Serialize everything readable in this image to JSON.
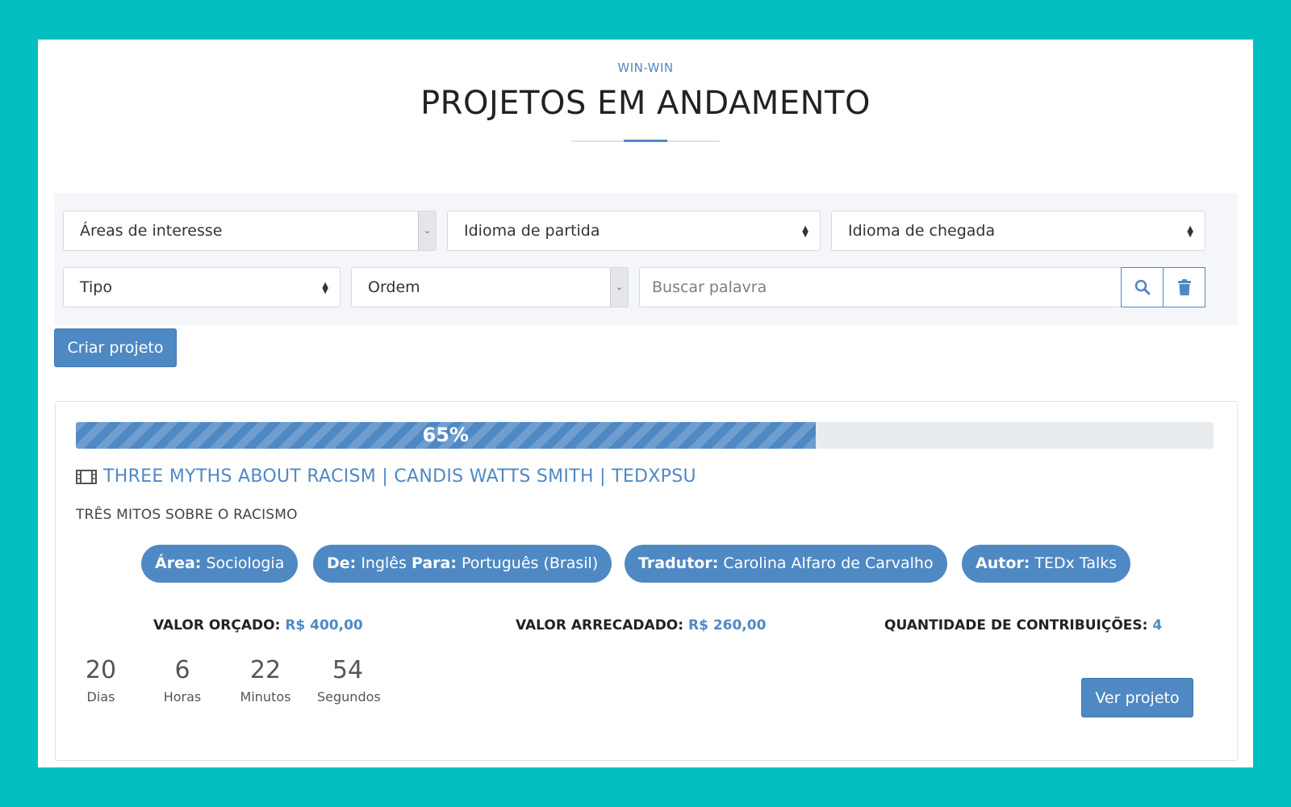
{
  "header": {
    "eyebrow": "WIN-WIN",
    "title": "PROJETOS EM ANDAMENTO"
  },
  "filters": {
    "areas": "Áreas de interesse",
    "source_language": "Idioma de partida",
    "target_language": "Idioma de chegada",
    "type": "Tipo",
    "order": "Ordem",
    "search_placeholder": "Buscar palavra",
    "search_icon": "search-icon",
    "clear_icon": "trash-icon"
  },
  "create_button": "Criar projeto",
  "project": {
    "progress_percent": 65,
    "progress_label": "65%",
    "title_icon": "film-icon",
    "title": "THREE MYTHS ABOUT RACISM | CANDIS WATTS SMITH | TEDXPSU",
    "subtitle": "TRÊS MITOS SOBRE O RACISMO",
    "chips": {
      "area_label": "Área:",
      "area_value": "Sociologia",
      "from_label": "De:",
      "from_value": "Inglês",
      "to_label": "Para:",
      "to_value": "Português (Brasil)",
      "translator_label": "Tradutor:",
      "translator_value": "Carolina Alfaro de Carvalho",
      "author_label": "Autor:",
      "author_value": "TEDx Talks"
    },
    "stats": {
      "budget_label": "VALOR ORÇADO:",
      "budget_value": "R$ 400,00",
      "raised_label": "VALOR ARRECADADO:",
      "raised_value": "R$ 260,00",
      "contrib_label": "QUANTIDADE DE CONTRIBUIÇÕES:",
      "contrib_value": "4"
    },
    "countdown": {
      "days": "20",
      "days_label": "Dias",
      "hours": "6",
      "hours_label": "Horas",
      "minutes": "22",
      "minutes_label": "Minutos",
      "seconds": "54",
      "seconds_label": "Segundos"
    },
    "view_button": "Ver projeto"
  },
  "colors": {
    "background": "#02c0c0",
    "accent": "#4f89c4"
  }
}
